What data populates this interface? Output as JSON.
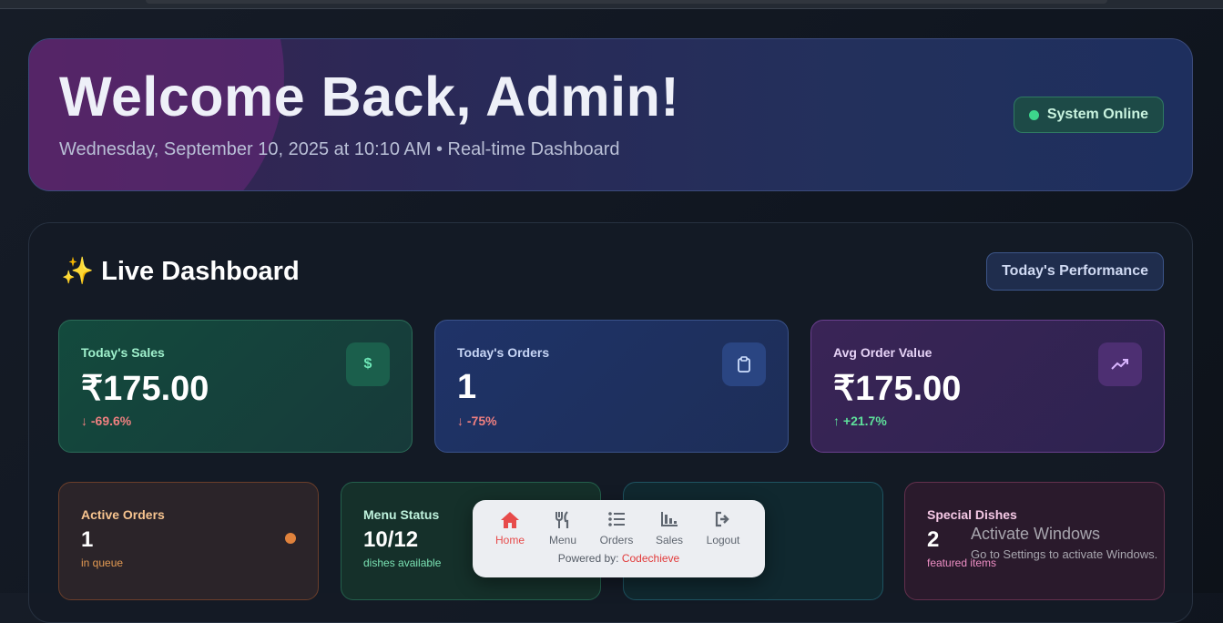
{
  "hero": {
    "title": "Welcome Back, Admin!",
    "subtitle": "Wednesday, September 10, 2025 at 10:10 AM • Real-time Dashboard",
    "status": "System Online"
  },
  "dashboard": {
    "sparkle": "✨",
    "title": "Live Dashboard",
    "period_button": "Today's Performance"
  },
  "stats": [
    {
      "label": "Today's Sales",
      "value": "₹175.00",
      "arrow": "↓",
      "change": "-69.6%",
      "icon": "dollar-icon",
      "icon_glyph": "$"
    },
    {
      "label": "Today's Orders",
      "value": "1",
      "arrow": "↓",
      "change": "-75%",
      "icon": "clipboard-icon"
    },
    {
      "label": "Avg Order Value",
      "value": "₹175.00",
      "arrow": "↑",
      "change": "+21.7%",
      "icon": "trending-up-icon"
    }
  ],
  "mini_cards": [
    {
      "label": "Active Orders",
      "value": "1",
      "sub": "in queue"
    },
    {
      "label": "Menu Status",
      "value": "10/12",
      "sub": "dishes available"
    },
    {
      "label": "Special Dishes",
      "value": "2",
      "sub": "featured items"
    }
  ],
  "bottom_nav": {
    "items": [
      {
        "label": "Home",
        "icon": "home-icon"
      },
      {
        "label": "Menu",
        "icon": "fork-knife-icon"
      },
      {
        "label": "Orders",
        "icon": "list-icon"
      },
      {
        "label": "Sales",
        "icon": "bar-chart-icon"
      },
      {
        "label": "Logout",
        "icon": "logout-icon"
      }
    ],
    "powered_prefix": "Powered by:",
    "powered_brand": "Codechieve"
  },
  "watermark": {
    "line1": "Activate Windows",
    "line2": "Go to Settings to activate Windows."
  },
  "colors": {
    "online": "#3dd68c",
    "down": "#f08080",
    "up": "#5ee19b",
    "nav_active": "#e74b4b"
  }
}
